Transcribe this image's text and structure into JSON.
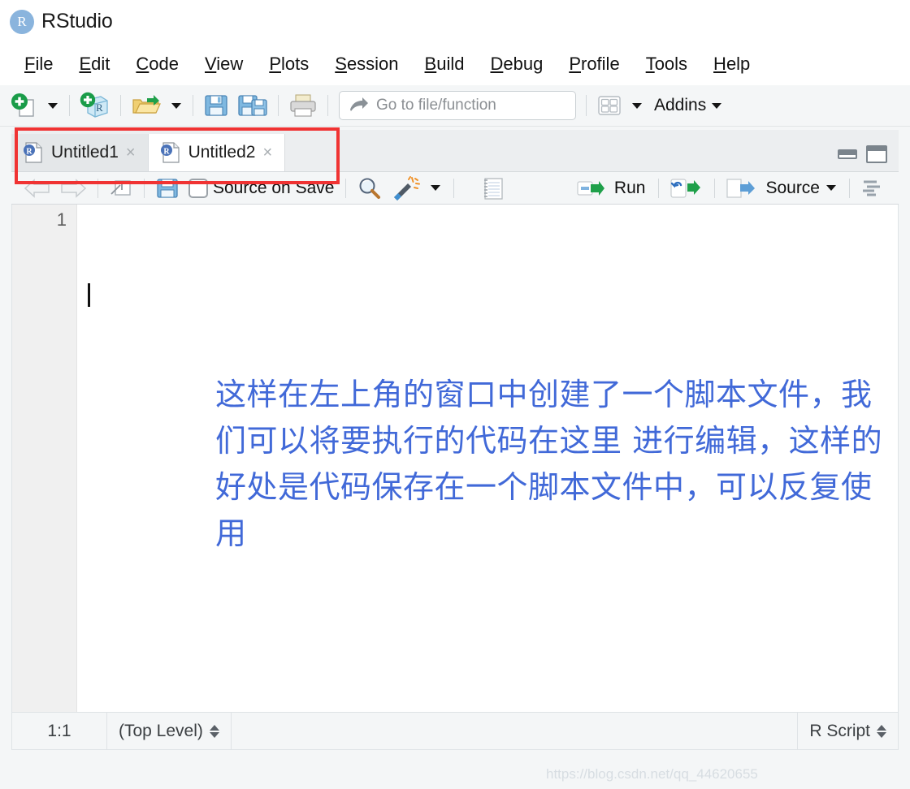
{
  "window": {
    "app_title": "RStudio",
    "logo_letter": "R"
  },
  "menubar": {
    "items": [
      {
        "label": "File",
        "accel": "F"
      },
      {
        "label": "Edit",
        "accel": "E"
      },
      {
        "label": "Code",
        "accel": "C"
      },
      {
        "label": "View",
        "accel": "V"
      },
      {
        "label": "Plots",
        "accel": "P"
      },
      {
        "label": "Session",
        "accel": "S"
      },
      {
        "label": "Build",
        "accel": "B"
      },
      {
        "label": "Debug",
        "accel": "D"
      },
      {
        "label": "Profile",
        "accel": "P"
      },
      {
        "label": "Tools",
        "accel": "T"
      },
      {
        "label": "Help",
        "accel": "H"
      }
    ]
  },
  "toolbar": {
    "icons": [
      "new-file-icon",
      "new-project-icon",
      "open-file-icon",
      "save-icon",
      "save-all-icon",
      "print-icon"
    ],
    "goto_placeholder": "Go to file/function",
    "goto_value": "",
    "pane_layout_icon": "pane-layout-icon",
    "addins_label": "Addins"
  },
  "source_pane": {
    "tabs": [
      {
        "label": "Untitled1",
        "icon": "r-file-icon",
        "close": "×",
        "active": false
      },
      {
        "label": "Untitled2",
        "icon": "r-file-icon",
        "close": "×",
        "active": true
      }
    ],
    "pane_controls": [
      "minimize-pane-icon",
      "maximize-pane-icon"
    ],
    "editor_toolbar": {
      "back_icon": "back-arrow-icon",
      "forward_icon": "forward-arrow-icon",
      "popout_icon": "show-in-new-window-icon",
      "save_icon": "save-icon",
      "source_on_save_label": "Source on Save",
      "source_on_save_checked": false,
      "find_icon": "magnifier-icon",
      "code_tools_icon": "magic-wand-icon",
      "compile_report_icon": "notebook-icon",
      "run_label": "Run",
      "rerun_icon": "rerun-icon",
      "source_label": "Source",
      "outline_icon": "document-outline-icon"
    },
    "editor": {
      "line_numbers": [
        "1"
      ],
      "content": ""
    },
    "statusbar": {
      "cursor_position": "1:1",
      "scope": "(Top Level)",
      "file_type": "R Script"
    }
  },
  "annotations": {
    "blue_note": "这样在左上角的窗口中创建了一个脚本文件，我们可以将要执行的代码在这里 进行编辑，这样的好处是代码保存在一个脚本文件中，可以反复使用",
    "blue_note_color": "#4169d8",
    "red_box_color": "#f03333",
    "watermark": "https://blog.csdn.net/qq_44620655"
  }
}
